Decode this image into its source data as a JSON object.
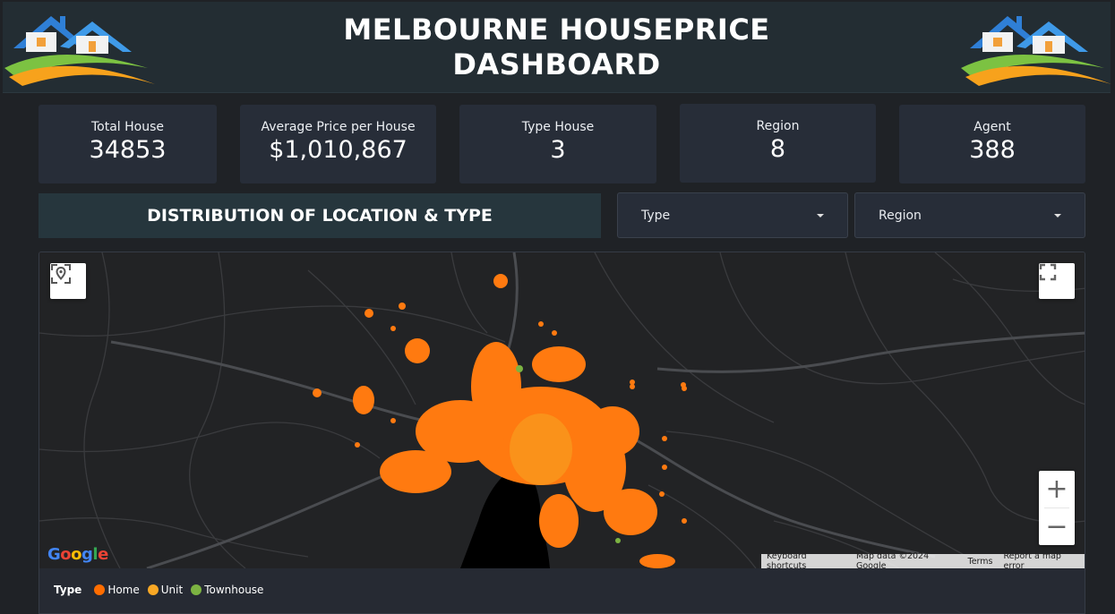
{
  "header": {
    "title_line1": "MELBOURNE HOUSEPRICE",
    "title_line2": "DASHBOARD"
  },
  "kpis": [
    {
      "label": "Total House",
      "value": "34853"
    },
    {
      "label": "Average Price per House",
      "value": "$1,010,867"
    },
    {
      "label": "Type House",
      "value": "3"
    },
    {
      "label": "Region",
      "value": "8"
    },
    {
      "label": "Agent",
      "value": "388"
    }
  ],
  "section": {
    "title": "DISTRIBUTION OF LOCATION & TYPE"
  },
  "filters": {
    "type_label": "Type",
    "region_label": "Region"
  },
  "map": {
    "provider_logo": "Google",
    "attribution": {
      "keyboard": "Keyboard shortcuts",
      "data": "Map data ©2024 Google",
      "terms": "Terms",
      "report": "Report a map error"
    },
    "icons": {
      "locate": "location-reset-icon",
      "fullscreen": "fullscreen-icon"
    }
  },
  "legend": {
    "title": "Type",
    "items": [
      {
        "label": "Home",
        "color": "#ff6d00"
      },
      {
        "label": "Unit",
        "color": "#f9a825"
      },
      {
        "label": "Townhouse",
        "color": "#7cb342"
      }
    ]
  },
  "colors": {
    "accent_orange": "#ff7a10",
    "header_bg": "#232d33",
    "card_bg": "#272d38"
  }
}
